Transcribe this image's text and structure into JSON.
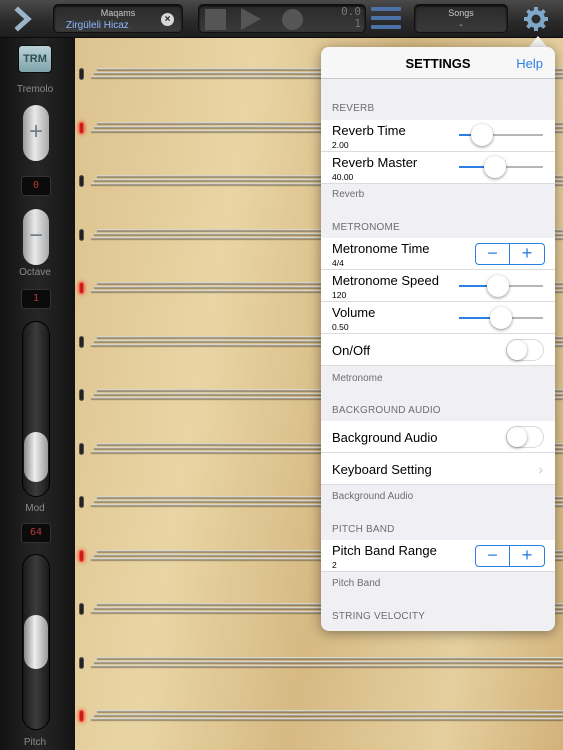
{
  "toolbar": {
    "maqams_title": "Maqams",
    "maqam_value": "Zirgüleli Hicaz",
    "songs_title": "Songs",
    "songs_value": "-",
    "counter_top": "0.0",
    "counter_bottom": "1"
  },
  "left_panel": {
    "trm_label": "TRM",
    "tremolo_label": "Tremolo",
    "octave_plus": "+",
    "octave_minus": "−",
    "octave_value": "0",
    "octave_label": "Octave",
    "octave_indicator": "1",
    "mod_label": "Mod",
    "mod_value": "64",
    "pitch_label": "Pitch"
  },
  "settings": {
    "title": "SETTINGS",
    "help_label": "Help",
    "reverb": {
      "header": "REVERB",
      "footer": "Reverb",
      "reverb_time": {
        "label": "Reverb Time",
        "value": "2.00",
        "fraction": 0.27
      },
      "reverb_master": {
        "label": "Reverb Master",
        "value": "40.00",
        "fraction": 0.43
      }
    },
    "metronome": {
      "header": "METRONOME",
      "footer": "Metronome",
      "time": {
        "label": "Metronome Time",
        "value": "4/4",
        "minus": "−",
        "plus": "+"
      },
      "speed": {
        "label": "Metronome Speed",
        "value": "120",
        "fraction": 0.46
      },
      "volume": {
        "label": "Volume",
        "value": "0.50",
        "fraction": 0.5
      },
      "onoff": {
        "label": "On/Off",
        "on": false
      }
    },
    "background_audio": {
      "header": "BACKGROUND AUDIO",
      "footer": "Background Audio",
      "toggle": {
        "label": "Background Audio",
        "on": false
      },
      "keyboard": {
        "label": "Keyboard Setting"
      }
    },
    "pitch_band": {
      "header": "PITCH BAND",
      "footer": "Pitch Band",
      "range": {
        "label": "Pitch Band Range",
        "value": "2",
        "minus": "−",
        "plus": "+"
      }
    },
    "string_velocity": {
      "header": "STRING VELOCITY"
    }
  },
  "colors": {
    "accent": "#2a7fe0",
    "toolbar_accent": "#4c72a8",
    "peg_active": "#c0201c",
    "wood_light": "#e9d5a4",
    "wood_dark": "#d2b27a"
  },
  "strings": {
    "groups": 13,
    "active_pegs": [
      1,
      4,
      9,
      12
    ]
  }
}
